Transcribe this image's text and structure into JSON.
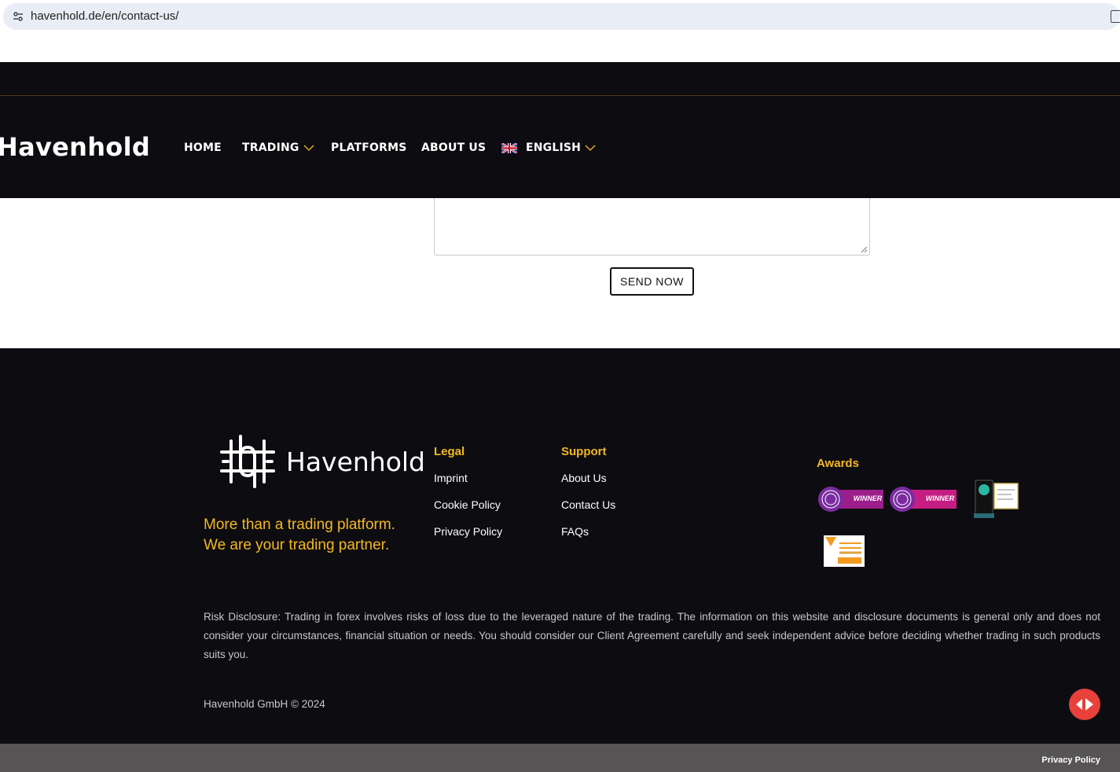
{
  "browser": {
    "url": "havenhold.de/en/contact-us/",
    "site_info_icon": "tune-icon",
    "extension_icon": "extension-icon"
  },
  "nav": {
    "brand": "Havenhold",
    "items": [
      {
        "label": "HOME"
      },
      {
        "label": "TRADING",
        "has_dropdown": true
      },
      {
        "label": "PLATFORMS"
      },
      {
        "label": "ABOUT US"
      },
      {
        "label": "ENGLISH",
        "has_dropdown": true,
        "icon": "uk-flag-icon"
      }
    ]
  },
  "form": {
    "send_label": "SEND NOW"
  },
  "footer": {
    "brand": "Havenhold",
    "tagline_line1": "More than a trading platform.",
    "tagline_line2": "We are your trading partner.",
    "legal": {
      "title": "Legal",
      "links": [
        "Imprint",
        "Cookie Policy",
        "Privacy Policy"
      ]
    },
    "support": {
      "title": "Support",
      "links": [
        "About Us",
        "Contact Us",
        "FAQs"
      ]
    },
    "awards": {
      "title": "Awards",
      "badge1_text": "WINNER",
      "badge2_text": "WINNER"
    },
    "risk_disclosure": "Risk Disclosure: Trading in forex involves risks of loss due to the leveraged nature of the trading. The information on this website and disclosure documents is general only and does not consider your circumstances, financial situation or needs. You should consider our Client Agreement carefully and seek independent advice before deciding whether trading in such products suits you.",
    "copyright": "Havenhold GmbH © 2024"
  },
  "bottom_bar": {
    "privacy_label": "Privacy Policy"
  },
  "colors": {
    "dark_bg": "#0d0c10",
    "accent_gold": "#f3b823",
    "chat_red": "#e8403a",
    "bottom_bar": "#575456"
  }
}
